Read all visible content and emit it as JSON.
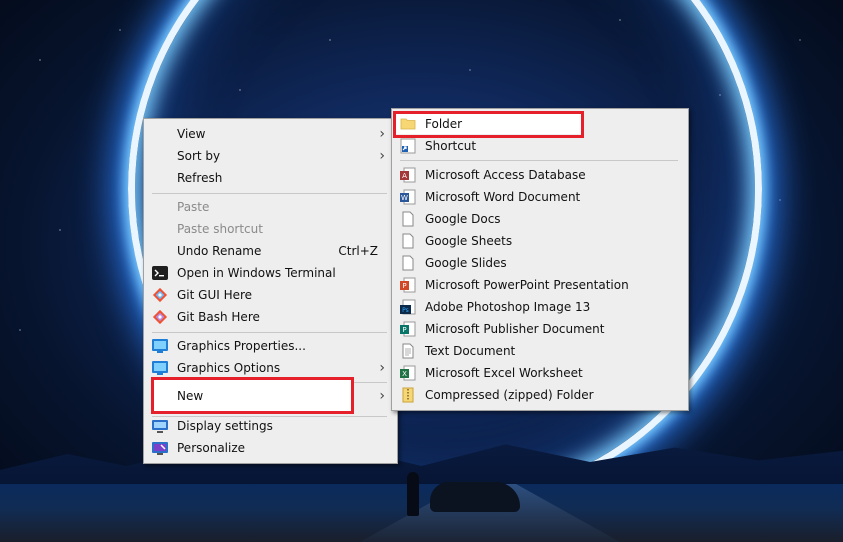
{
  "context_menu": {
    "items": [
      {
        "label": "View",
        "submenu": true,
        "icon": null
      },
      {
        "label": "Sort by",
        "submenu": true,
        "icon": null
      },
      {
        "label": "Refresh",
        "icon": null
      },
      {
        "label": "Paste",
        "disabled": true
      },
      {
        "label": "Paste shortcut",
        "disabled": true
      },
      {
        "label": "Undo Rename",
        "shortcut": "Ctrl+Z"
      },
      {
        "label": "Open in Windows Terminal",
        "icon": "terminal-icon"
      },
      {
        "label": "Git GUI Here",
        "icon": "git-icon"
      },
      {
        "label": "Git Bash Here",
        "icon": "git-icon"
      },
      {
        "label": "Graphics Properties...",
        "icon": "graphics-icon"
      },
      {
        "label": "Graphics Options",
        "icon": "graphics-icon",
        "submenu": true
      },
      {
        "label": "New",
        "submenu": true,
        "highlighted": true
      },
      {
        "label": "Display settings",
        "icon": "display-icon"
      },
      {
        "label": "Personalize",
        "icon": "personalize-icon"
      }
    ]
  },
  "new_submenu": {
    "items": [
      {
        "label": "Folder",
        "icon": "folder-icon",
        "highlighted": true
      },
      {
        "label": "Shortcut",
        "icon": "shortcut-icon"
      },
      {
        "label": "Microsoft Access Database",
        "icon": "access-icon"
      },
      {
        "label": "Microsoft Word Document",
        "icon": "word-icon"
      },
      {
        "label": "Google Docs",
        "icon": "blank-doc-icon"
      },
      {
        "label": "Google Sheets",
        "icon": "blank-doc-icon"
      },
      {
        "label": "Google Slides",
        "icon": "blank-doc-icon"
      },
      {
        "label": "Microsoft PowerPoint Presentation",
        "icon": "powerpoint-icon"
      },
      {
        "label": "Adobe Photoshop Image 13",
        "icon": "photoshop-icon"
      },
      {
        "label": "Microsoft Publisher Document",
        "icon": "publisher-icon"
      },
      {
        "label": "Text Document",
        "icon": "text-doc-icon"
      },
      {
        "label": "Microsoft Excel Worksheet",
        "icon": "excel-icon"
      },
      {
        "label": "Compressed (zipped) Folder",
        "icon": "zip-folder-icon"
      }
    ]
  },
  "colors": {
    "highlight_border": "#e5202a",
    "menu_bg": "#eeeeee"
  }
}
